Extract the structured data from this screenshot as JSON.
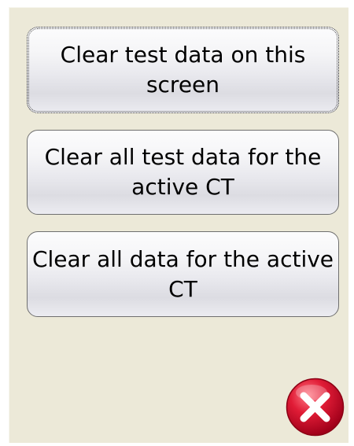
{
  "buttons": {
    "clear_screen": "Clear test data on this screen",
    "clear_all_test": "Clear all test data for the active CT",
    "clear_all": "Clear all data for the active CT"
  },
  "icons": {
    "close": "close-x-icon"
  },
  "colors": {
    "panel_background": "#ece9d8",
    "close_red": "#d8102c"
  }
}
